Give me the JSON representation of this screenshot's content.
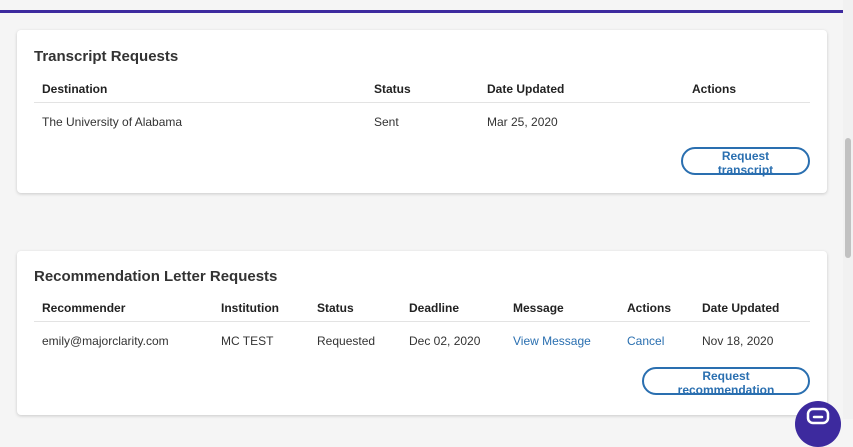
{
  "colors": {
    "accent": "#2a6fb0",
    "brand": "#3d2a9e"
  },
  "transcript": {
    "title": "Transcript Requests",
    "headers": [
      "Destination",
      "Status",
      "Date Updated",
      "Actions"
    ],
    "rows": [
      {
        "destination": "The University of Alabama",
        "status": "Sent",
        "date_updated": "Mar 25, 2020",
        "actions": ""
      }
    ],
    "button_label": "Request transcript"
  },
  "recommendation": {
    "title": "Recommendation Letter Requests",
    "headers": [
      "Recommender",
      "Institution",
      "Status",
      "Deadline",
      "Message",
      "Actions",
      "Date Updated"
    ],
    "rows": [
      {
        "recommender": "emily@majorclarity.com",
        "institution": "MC TEST",
        "status": "Requested",
        "deadline": "Dec 02, 2020",
        "message": "View Message",
        "action": "Cancel",
        "date_updated": "Nov 18, 2020"
      }
    ],
    "button_label": "Request recommendation"
  },
  "chat": {
    "icon": "chat-icon"
  }
}
